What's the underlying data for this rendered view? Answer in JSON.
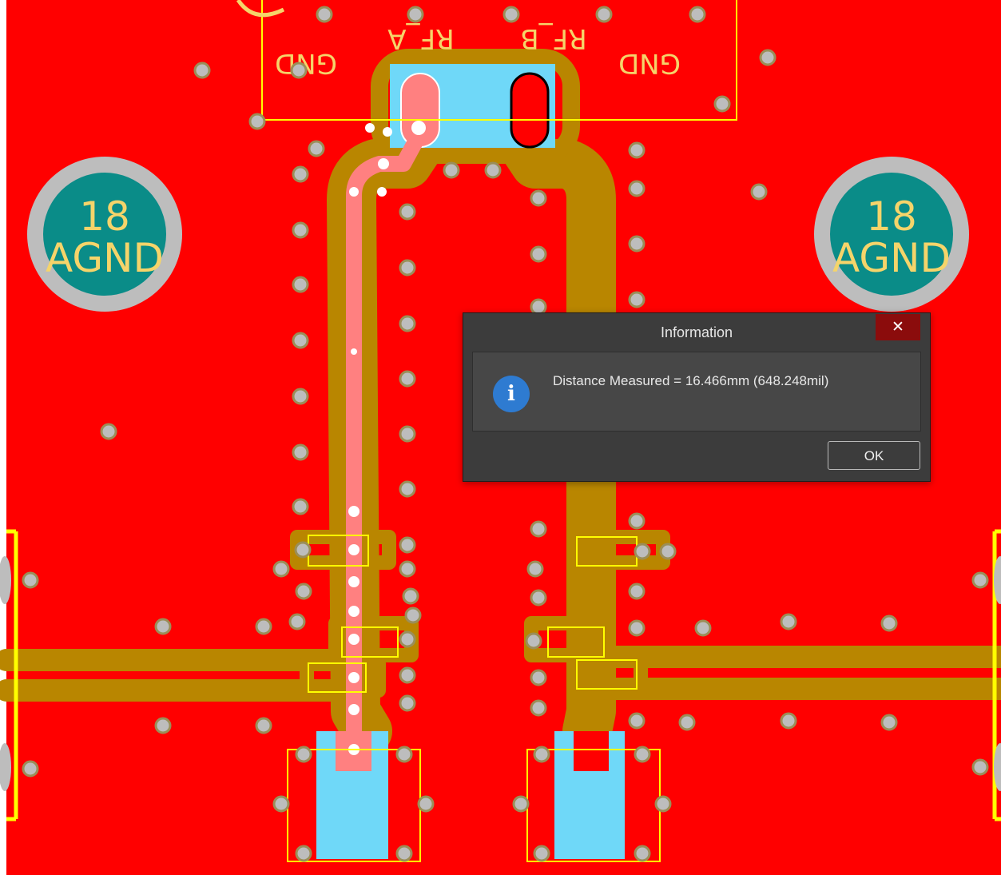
{
  "pcb": {
    "colors": {
      "board_copper": "#ff0000",
      "trace": "#b98600",
      "pad": "#6fd8f8",
      "silkscreen": "#ffff00",
      "via_ring": "#9b8e58",
      "ground_pad": "#0a8c88",
      "ground_ring": "#bdbdbd",
      "highlight": "#ff8080"
    },
    "silkscreen": {
      "gnd_left": "GND",
      "rf_a": "RF_A",
      "rf_b": "RF_B",
      "gnd_right": "GND"
    },
    "ground_pads": [
      {
        "net_number": "18",
        "net_name": "AGND"
      },
      {
        "net_number": "18",
        "net_name": "AGND"
      }
    ]
  },
  "dialog": {
    "title": "Information",
    "close_glyph": "✕",
    "icon": "info-icon",
    "icon_glyph": "i",
    "message": "Distance Measured = 16.466mm (648.248mil)",
    "ok_label": "OK"
  }
}
